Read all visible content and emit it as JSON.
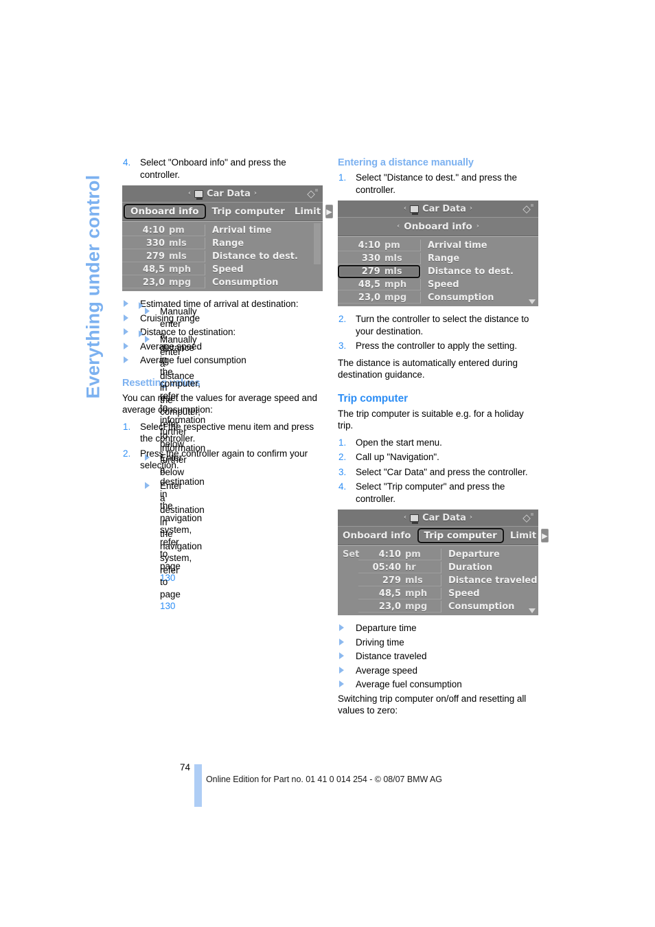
{
  "sidebar": {
    "chapter_label": "Everything under control"
  },
  "footer": {
    "page_number": "74",
    "notice": "Online Edition for Part no. 01 41 0 014 254 - © 08/07 BMW AG"
  },
  "left_column": {
    "step4": {
      "num": "4.",
      "text": "Select \"Onboard info\" and press the controller."
    },
    "screen_onboard": {
      "title": "Car Data",
      "title_icon": "monitor-icon",
      "arrow_left": "‹",
      "arrow_right": "›",
      "hud_icon": "hud-icon",
      "tabs": [
        {
          "label": "Onboard info",
          "selected": true
        },
        {
          "label": "Trip computer",
          "selected": false
        },
        {
          "label": "Limit",
          "selected": false
        }
      ],
      "next_arrow": "▶",
      "rows": [
        {
          "value": "4:10",
          "unit": "pm",
          "label": "Arrival time",
          "highlight": false
        },
        {
          "value": "330",
          "unit": "mls",
          "label": "Range",
          "highlight": false
        },
        {
          "value": "279",
          "unit": "mls",
          "label": "Distance to dest.",
          "highlight": false
        },
        {
          "value": "48,5",
          "unit": "mph",
          "label": "Speed",
          "highlight": false
        },
        {
          "value": "23,0",
          "unit": "mpg",
          "label": "Consumption",
          "highlight": false
        }
      ]
    },
    "bullets": [
      {
        "text": "Estimated time of arrival at destination:",
        "sub": [
          {
            "text": "Manually enter a distance in the computer, refer to information further below"
          },
          {
            "text": "Enter a destination in the navigation system, refer to page ",
            "page": "130"
          }
        ]
      },
      {
        "text": "Cruising range",
        "sub": []
      },
      {
        "text": "Distance to destination:",
        "sub": [
          {
            "text": "Manually enter a distance in the computer, refer to information further below"
          },
          {
            "text": "Enter a destination in the navigation system, refer to page ",
            "page": "130"
          }
        ]
      },
      {
        "text": "Average speed",
        "sub": []
      },
      {
        "text": "Average fuel consumption",
        "sub": []
      }
    ],
    "resetting": {
      "heading": "Resetting values",
      "intro": "You can reset the values for average speed and average consumption:",
      "steps": [
        {
          "num": "1.",
          "text": "Select the respective menu item and press the controller."
        },
        {
          "num": "2.",
          "text": "Press the controller again to confirm your selection."
        }
      ]
    }
  },
  "right_column": {
    "entering": {
      "heading": "Entering a distance manually",
      "step1": {
        "num": "1.",
        "text": "Select \"Distance to dest.\" and press the controller."
      },
      "steps_after": [
        {
          "num": "2.",
          "text": "Turn the controller to select the distance to your destination."
        },
        {
          "num": "3.",
          "text": "Press the controller to apply the setting."
        }
      ],
      "note": "The distance is automatically entered during destination guidance."
    },
    "screen_distance": {
      "title": "Car Data",
      "title_icon": "monitor-icon",
      "arrow_left": "‹",
      "arrow_right": "›",
      "hud_icon": "hud-icon",
      "subtab": "Onboard info",
      "rows": [
        {
          "value": "4:10",
          "unit": "pm",
          "label": "Arrival time",
          "highlight": false
        },
        {
          "value": "330",
          "unit": "mls",
          "label": "Range",
          "highlight": false
        },
        {
          "value": "279",
          "unit": "mls",
          "label": "Distance to dest.",
          "highlight": true
        },
        {
          "value": "48,5",
          "unit": "mph",
          "label": "Speed",
          "highlight": false
        },
        {
          "value": "23,0",
          "unit": "mpg",
          "label": "Consumption",
          "highlight": false
        }
      ]
    },
    "trip": {
      "heading": "Trip computer",
      "intro": "The trip computer is suitable e.g. for a holiday trip.",
      "steps": [
        {
          "num": "1.",
          "text": "Open the start menu."
        },
        {
          "num": "2.",
          "text": "Call up \"Navigation\"."
        },
        {
          "num": "3.",
          "text": "Select \"Car Data\" and press the controller."
        },
        {
          "num": "4.",
          "text": "Select \"Trip computer\" and press the controller."
        }
      ],
      "bullets": [
        "Departure time",
        "Driving time",
        "Distance traveled",
        "Average speed",
        "Average fuel consumption"
      ],
      "closing": "Switching trip computer on/off and resetting all values to zero:"
    },
    "screen_trip": {
      "title": "Car Data",
      "title_icon": "monitor-icon",
      "arrow_left": "‹",
      "arrow_right": "›",
      "hud_icon": "hud-icon",
      "tabs": [
        {
          "label": "Onboard info",
          "selected": false
        },
        {
          "label": "Trip computer",
          "selected": true
        },
        {
          "label": "Limit",
          "selected": false
        }
      ],
      "next_arrow": "▶",
      "set_label": "Set",
      "rows": [
        {
          "set": "Set",
          "value": "4:10",
          "unit": "pm",
          "label": "Departure",
          "highlight": false
        },
        {
          "set": "",
          "value": "05:40",
          "unit": "hr",
          "label": "Duration",
          "highlight": false
        },
        {
          "set": "",
          "value": "279",
          "unit": "mls",
          "label": "Distance traveled",
          "highlight": false
        },
        {
          "set": "",
          "value": "48,5",
          "unit": "mph",
          "label": "Speed",
          "highlight": false
        },
        {
          "set": "",
          "value": "23,0",
          "unit": "mpg",
          "label": "Consumption",
          "highlight": false
        }
      ]
    }
  }
}
